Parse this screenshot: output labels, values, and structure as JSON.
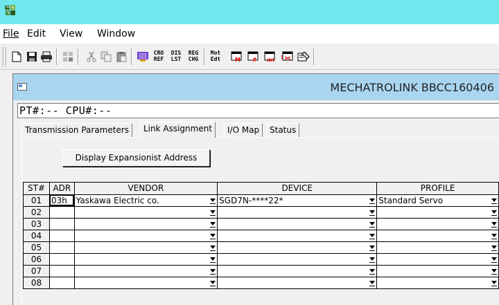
{
  "menus": [
    "File",
    "Edit",
    "View",
    "Window"
  ],
  "toolbar": {
    "text_buttons": [
      {
        "name": "cro-ref-button",
        "line1": "CRO",
        "line2": "REF"
      },
      {
        "name": "dis-lst-button",
        "line1": "DIS",
        "line2": "LST"
      },
      {
        "name": "reg-chg-button",
        "line1": "REG",
        "line2": "CHG"
      },
      {
        "name": "mot-edt-button",
        "line1": "Mot",
        "line2": "Edt"
      }
    ]
  },
  "window": {
    "title": "MECHATROLINK   BBCC160406",
    "status": "PT#:-- CPU#:--"
  },
  "tabs": [
    "Transmission Parameters",
    "Link Assignment",
    "I/O Map",
    "Status"
  ],
  "active_tab": "Link Assignment",
  "display_button_label": "Display Expansionist Address",
  "table": {
    "headers": [
      "ST#",
      "ADR",
      "VENDOR",
      "DEVICE",
      "PROFILE"
    ],
    "rows": [
      {
        "st": "01",
        "adr": "03h",
        "vendor": "Yaskawa Electric co.",
        "device": "SGD7N-****22*",
        "profile": "Standard Servo"
      },
      {
        "st": "02",
        "adr": "",
        "vendor": "",
        "device": "",
        "profile": ""
      },
      {
        "st": "03",
        "adr": "",
        "vendor": "",
        "device": "",
        "profile": ""
      },
      {
        "st": "04",
        "adr": "",
        "vendor": "",
        "device": "",
        "profile": ""
      },
      {
        "st": "05",
        "adr": "",
        "vendor": "",
        "device": "",
        "profile": ""
      },
      {
        "st": "06",
        "adr": "",
        "vendor": "",
        "device": "",
        "profile": ""
      },
      {
        "st": "07",
        "adr": "",
        "vendor": "",
        "device": "",
        "profile": ""
      },
      {
        "st": "08",
        "adr": "",
        "vendor": "",
        "device": "",
        "profile": ""
      }
    ]
  },
  "colors": {
    "titlebar": "#6ee7ef",
    "mdi_title": "#a9d5f0"
  }
}
